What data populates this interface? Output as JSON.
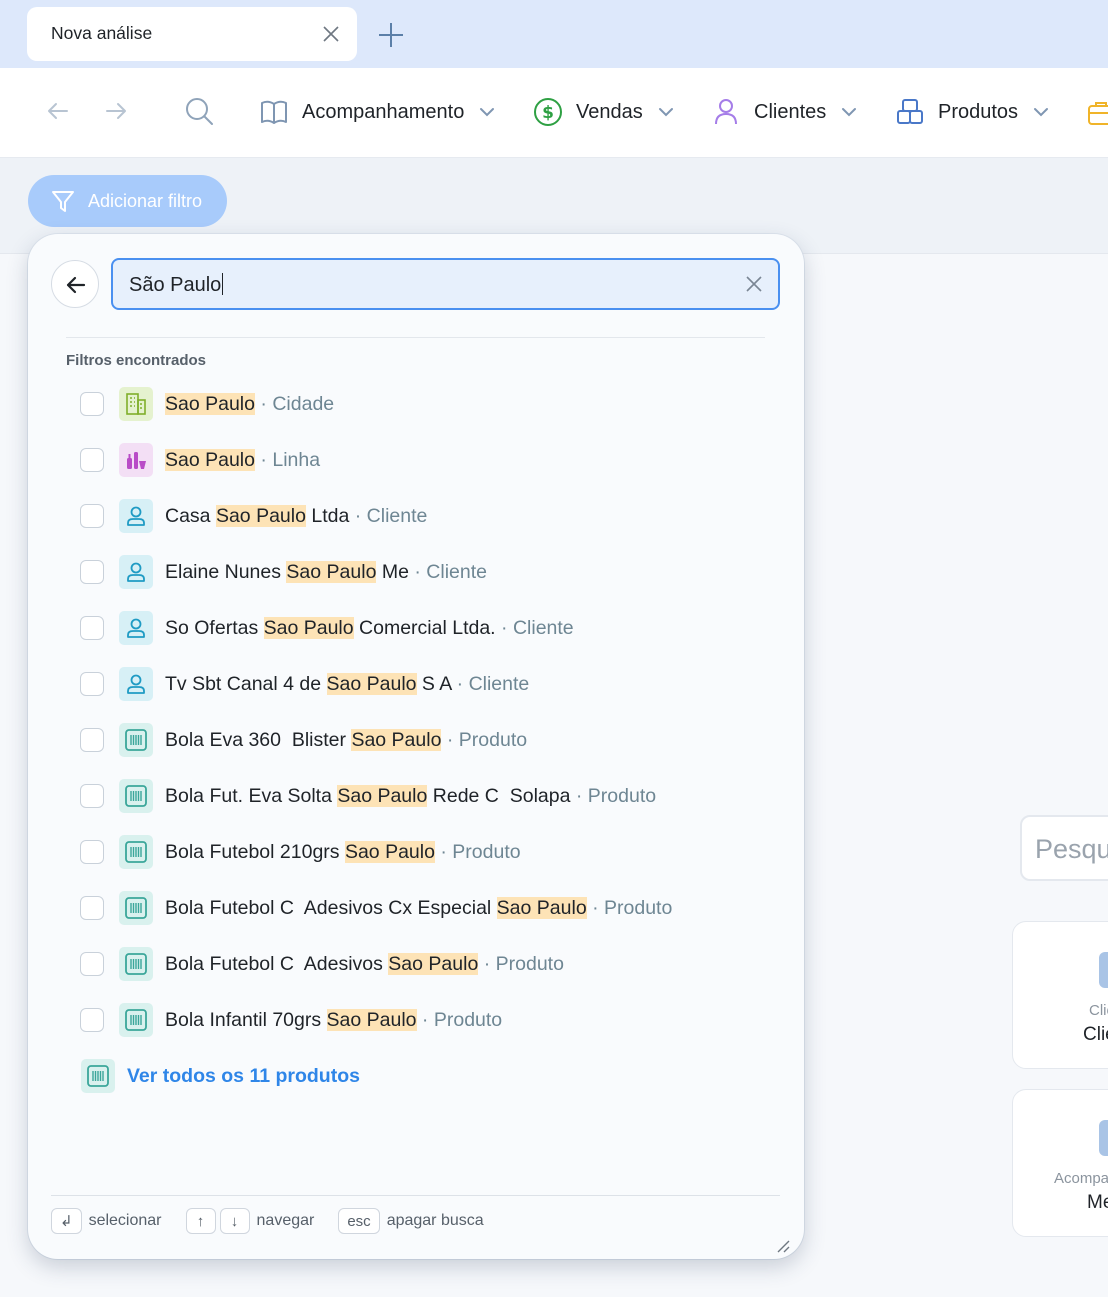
{
  "tab": {
    "title": "Nova análise"
  },
  "nav": {
    "items": [
      {
        "label": "Acompanhamento",
        "icon": "book-open-icon"
      },
      {
        "label": "Vendas",
        "icon": "dollar-circle-icon"
      },
      {
        "label": "Clientes",
        "icon": "user-icon"
      },
      {
        "label": "Produtos",
        "icon": "boxes-icon"
      }
    ]
  },
  "filter_button": {
    "label": "Adicionar filtro"
  },
  "search": {
    "value": "São Paulo"
  },
  "results": {
    "section_title": "Filtros encontrados",
    "items": [
      {
        "before": "",
        "highlight": "Sao Paulo",
        "after": "",
        "type": "Cidade",
        "icon": "building-icon"
      },
      {
        "before": "",
        "highlight": "Sao Paulo",
        "after": "",
        "type": "Linha",
        "icon": "bottles-icon"
      },
      {
        "before": "Casa ",
        "highlight": "Sao Paulo",
        "after": " Ltda",
        "type": "Cliente",
        "icon": "user-icon"
      },
      {
        "before": "Elaine Nunes ",
        "highlight": "Sao Paulo",
        "after": " Me",
        "type": "Cliente",
        "icon": "user-icon"
      },
      {
        "before": "So Ofertas ",
        "highlight": "Sao Paulo",
        "after": " Comercial Ltda.",
        "type": "Cliente",
        "icon": "user-icon"
      },
      {
        "before": "Tv Sbt Canal 4 de ",
        "highlight": "Sao Paulo",
        "after": " S A",
        "type": "Cliente",
        "icon": "user-icon"
      },
      {
        "before": "Bola Eva 360  Blister ",
        "highlight": "Sao Paulo",
        "after": "",
        "type": "Produto",
        "icon": "barcode-icon"
      },
      {
        "before": "Bola Fut. Eva Solta ",
        "highlight": "Sao Paulo",
        "after": " Rede C  Solapa",
        "type": "Produto",
        "icon": "barcode-icon"
      },
      {
        "before": "Bola Futebol 210grs ",
        "highlight": "Sao Paulo",
        "after": "",
        "type": "Produto",
        "icon": "barcode-icon"
      },
      {
        "before": "Bola Futebol C  Adesivos Cx Especial ",
        "highlight": "Sao Paulo",
        "after": "",
        "type": "Produto",
        "icon": "barcode-icon"
      },
      {
        "before": "Bola Futebol C  Adesivos ",
        "highlight": "Sao Paulo",
        "after": "",
        "type": "Produto",
        "icon": "barcode-icon"
      },
      {
        "before": "Bola Infantil 70grs ",
        "highlight": "Sao Paulo",
        "after": "",
        "type": "Produto",
        "icon": "barcode-icon"
      }
    ],
    "see_all": "Ver todos os 11 produtos"
  },
  "footer": {
    "select_key": "↲",
    "select_label": "selecionar",
    "up_key": "↑",
    "down_key": "↓",
    "navigate_label": "navegar",
    "esc_key": "esc",
    "clear_label": "apagar busca"
  },
  "background": {
    "search_placeholder": "Pesqu",
    "card1_line1": "Clie",
    "card1_line2": "Clie",
    "card2_line1": "Acompa",
    "card2_line2": "Me"
  },
  "colors": {
    "accent": "#4a90f0",
    "highlight": "#fde3b6",
    "filter_button": "#a8cbfb",
    "city_icon_bg": "#e5f2cf",
    "line_icon_bg": "#f3dff5",
    "client_icon_bg": "#d7f0f6",
    "product_icon_bg": "#d9f1ee"
  }
}
